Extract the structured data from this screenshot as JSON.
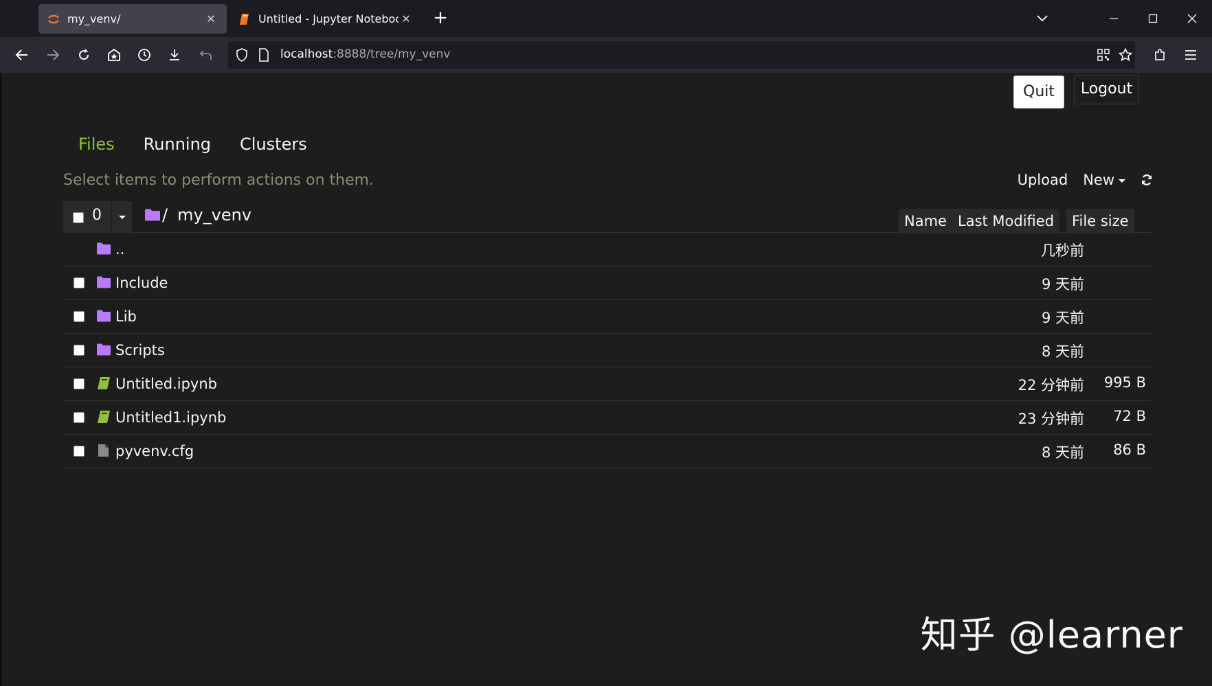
{
  "browser": {
    "tabs": [
      {
        "title": "my_venv/",
        "active": true,
        "icon": "jupyter-logo-icon"
      },
      {
        "title": "Untitled - Jupyter Notebook",
        "active": false,
        "icon": "notebook-icon"
      }
    ],
    "new_tab_label": "+",
    "url_host": "localhost",
    "url_rest": ":8888/tree/my_venv",
    "colors": {
      "chrome_bg": "#1c1b22",
      "toolbar_bg": "#2b2a33",
      "active_tab_bg": "#42414d"
    }
  },
  "header": {
    "quit_label": "Quit",
    "logout_label": "Logout"
  },
  "main_tabs": [
    {
      "label": "Files",
      "active": true
    },
    {
      "label": "Running",
      "active": false
    },
    {
      "label": "Clusters",
      "active": false
    }
  ],
  "toolbar": {
    "hint": "Select items to perform actions on them.",
    "upload_label": "Upload",
    "new_label": "New",
    "refresh_icon": "refresh-icon"
  },
  "list_header": {
    "selected_count": "0",
    "breadcrumb_sep": "/",
    "breadcrumb_folder": "my_venv",
    "sort_name_label": "Name",
    "sort_modified_label": "Last Modified",
    "sort_size_label": "File size"
  },
  "files": [
    {
      "name": "..",
      "type": "folder",
      "modified": "几秒前",
      "size": "",
      "checkbox": false
    },
    {
      "name": "Include",
      "type": "folder",
      "modified": "9 天前",
      "size": "",
      "checkbox": true
    },
    {
      "name": "Lib",
      "type": "folder",
      "modified": "9 天前",
      "size": "",
      "checkbox": true
    },
    {
      "name": "Scripts",
      "type": "folder",
      "modified": "8 天前",
      "size": "",
      "checkbox": true
    },
    {
      "name": "Untitled.ipynb",
      "type": "notebook",
      "modified": "22 分钟前",
      "size": "995 B",
      "checkbox": true
    },
    {
      "name": "Untitled1.ipynb",
      "type": "notebook",
      "modified": "23 分钟前",
      "size": "72 B",
      "checkbox": true
    },
    {
      "name": "pyvenv.cfg",
      "type": "file",
      "modified": "8 天前",
      "size": "86 B",
      "checkbox": true
    }
  ],
  "colors": {
    "folder": "#b77cf5",
    "notebook": "#8ec03d",
    "file": "#8a8a8a",
    "active_tab_text": "#8ec03d",
    "page_bg": "#1d1d1d"
  },
  "watermark": "知乎 @learner"
}
